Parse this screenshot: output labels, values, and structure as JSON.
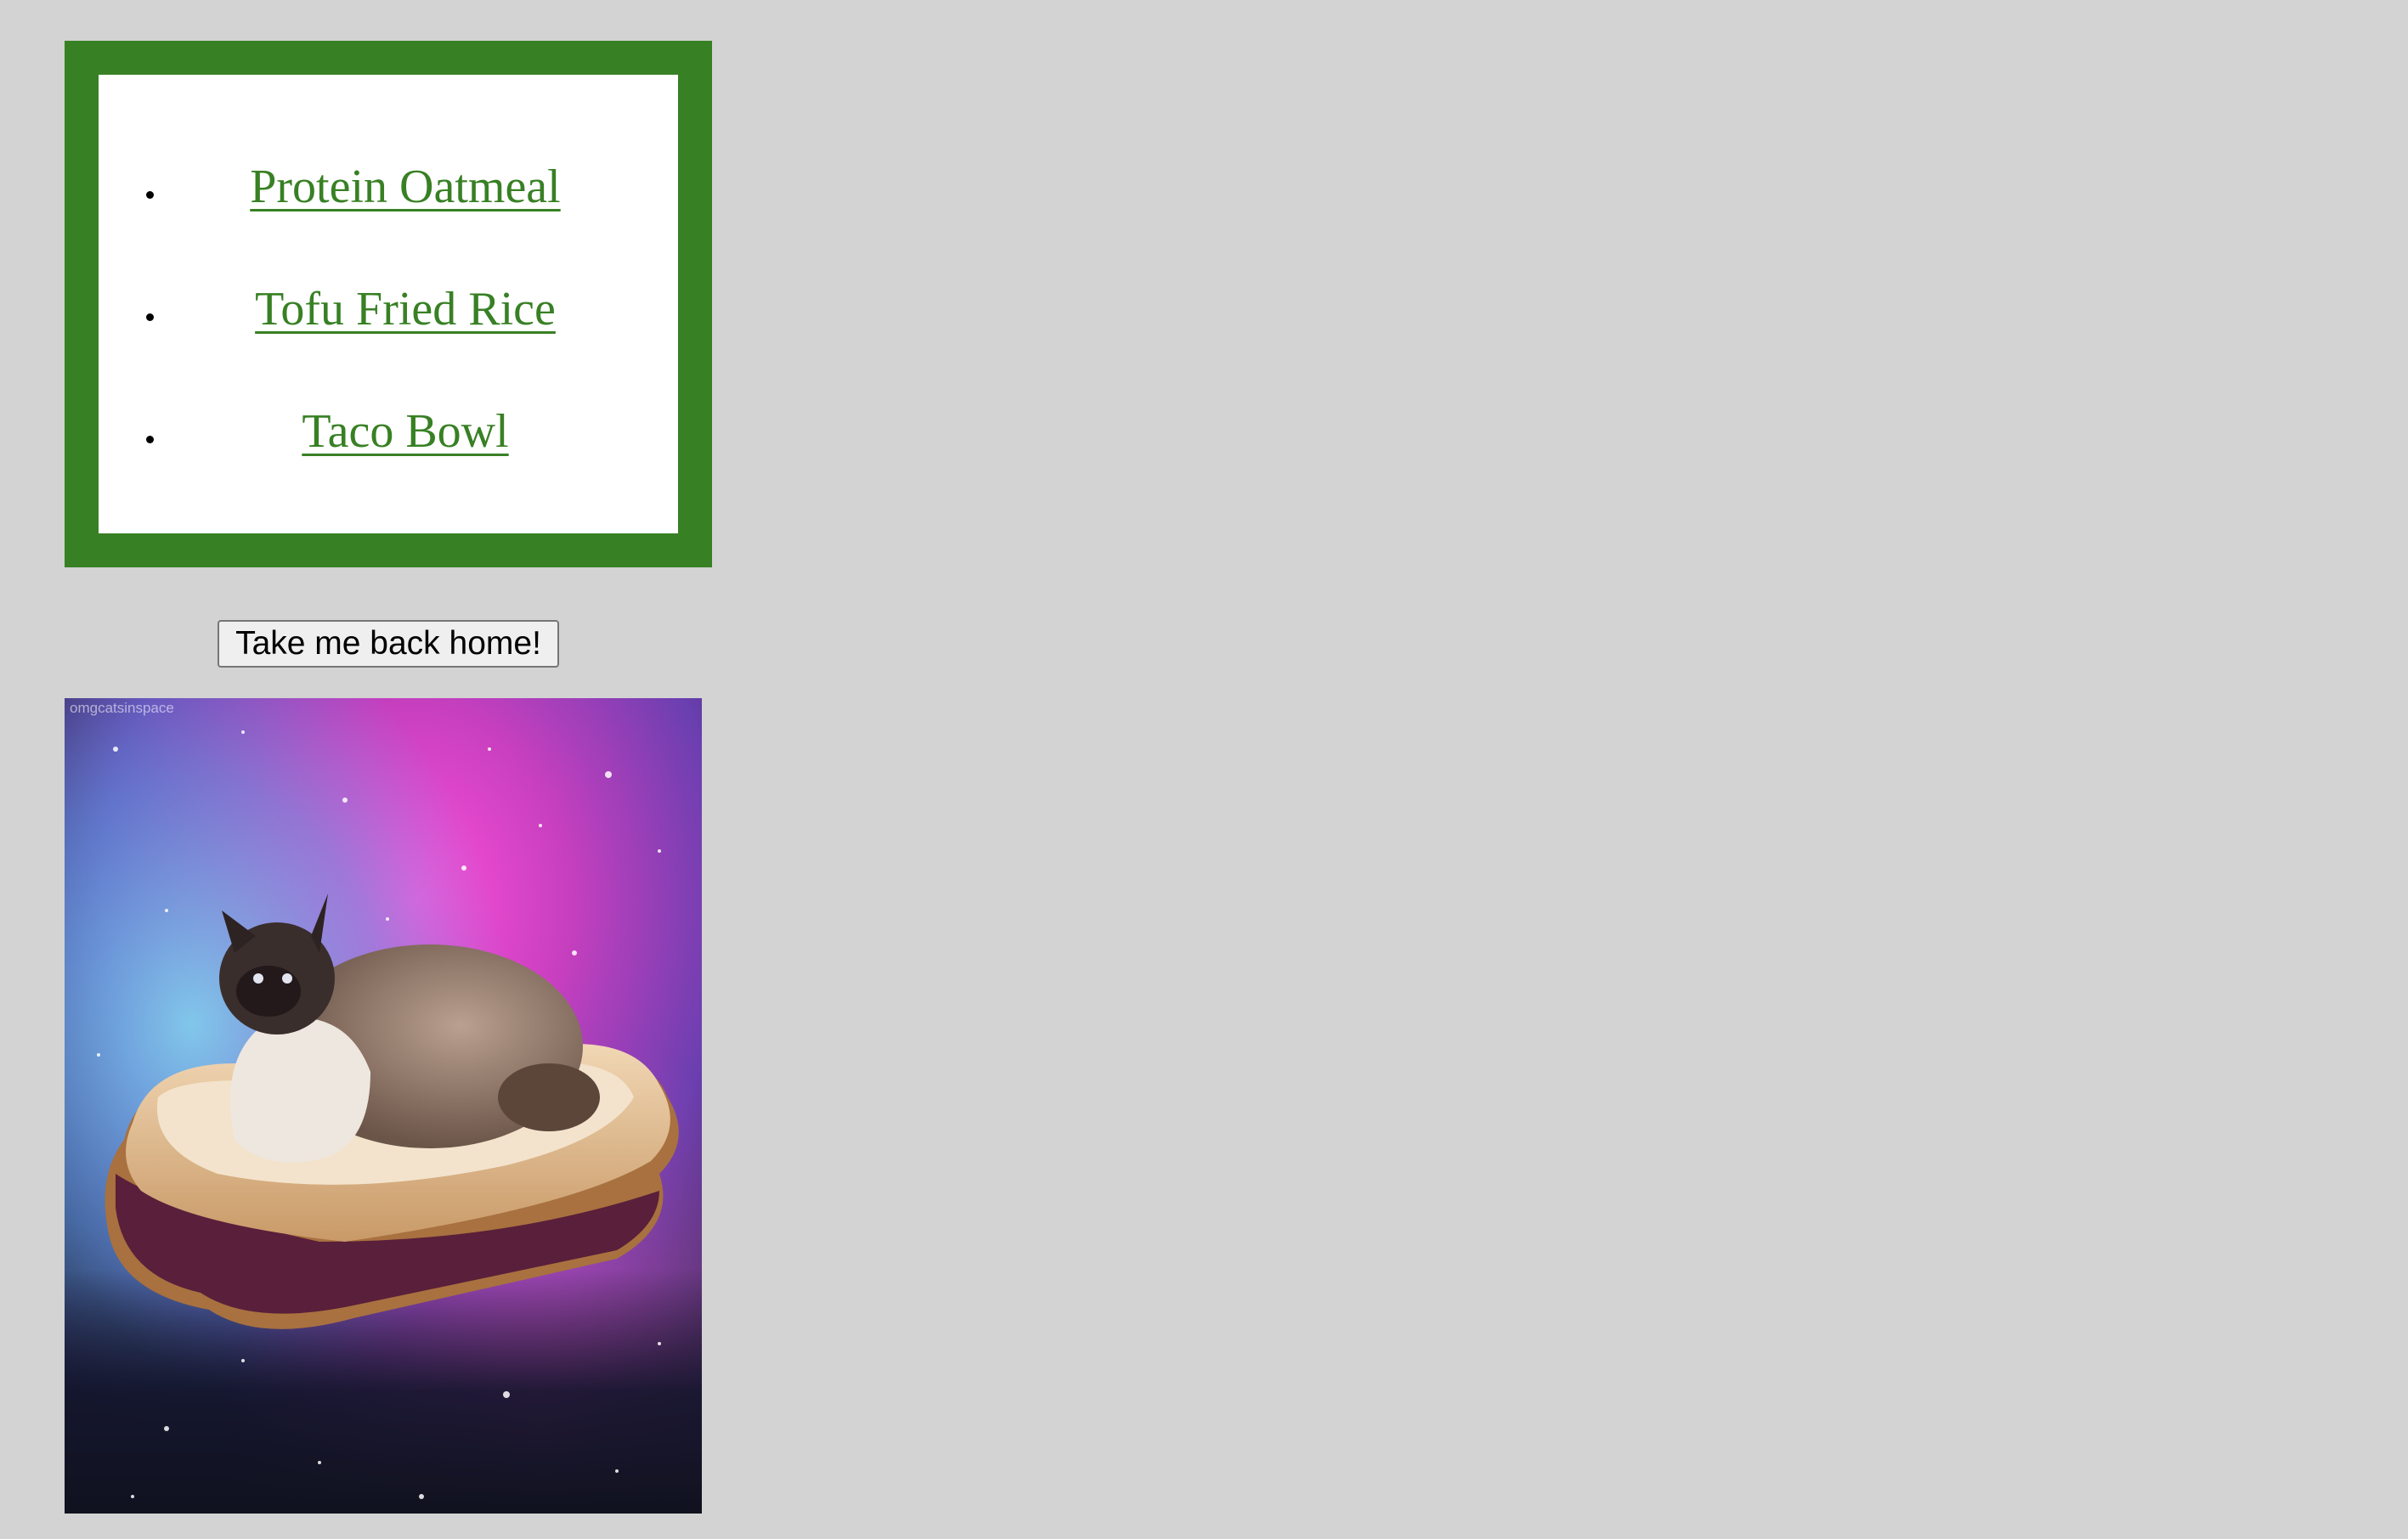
{
  "menu": {
    "items": [
      {
        "label": "Protein Oatmeal"
      },
      {
        "label": "Tofu Fried Rice"
      },
      {
        "label": "Taco Bowl"
      }
    ]
  },
  "home_button": {
    "label": "Take me back home!"
  },
  "image": {
    "subject": "cat sitting on peanut butter and jelly sandwich in outer space",
    "watermark": "omgcatsinspace"
  },
  "colors": {
    "page_background": "#d3d3d3",
    "accent_green": "#388024",
    "box_background": "#ffffff"
  }
}
